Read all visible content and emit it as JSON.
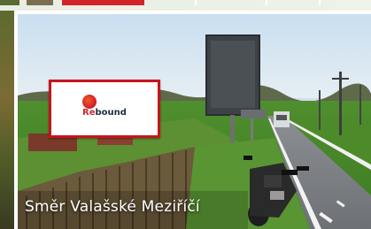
{
  "top_strip": {
    "accent_color": "#d2232a"
  },
  "photo": {
    "caption": "Směr Valašské Meziříčí",
    "billboard": {
      "brand_prefix": "Re",
      "brand_suffix": "bound",
      "brand_color": "#d2232a",
      "frame_color": "#c4161c"
    }
  }
}
